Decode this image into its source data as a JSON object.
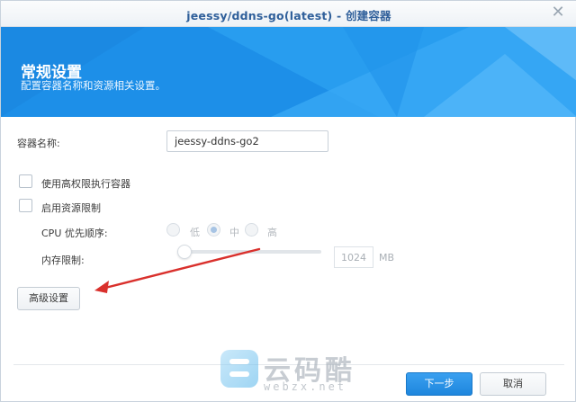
{
  "window": {
    "title": "jeessy/ddns-go(latest) - 创建容器",
    "close_glyph": "✕"
  },
  "banner": {
    "title": "常规设置",
    "subtitle": "配置容器名称和资源相关设置。",
    "color": "#1e8fe6"
  },
  "form": {
    "container_name_label": "容器名称:",
    "container_name_value": "jeessy-ddns-go2",
    "privileged_label": "使用高权限执行容器",
    "privileged_checked": false,
    "resource_limit_label": "启用资源限制",
    "resource_limit_checked": false,
    "cpu_priority_label": "CPU 优先顺序:",
    "cpu_options": [
      "低",
      "中",
      "高"
    ],
    "cpu_selected": "中",
    "memory_label": "内存限制:",
    "memory_slider_fraction": 0.0,
    "memory_value": "1024",
    "memory_unit": "MB"
  },
  "buttons": {
    "advanced": "高级设置",
    "next": "下一步",
    "cancel": "取消"
  },
  "watermark": {
    "text": "云码酷",
    "sub": "webzx.net"
  },
  "colors": {
    "accent": "#1e86dd",
    "arrow": "#d9302c"
  }
}
